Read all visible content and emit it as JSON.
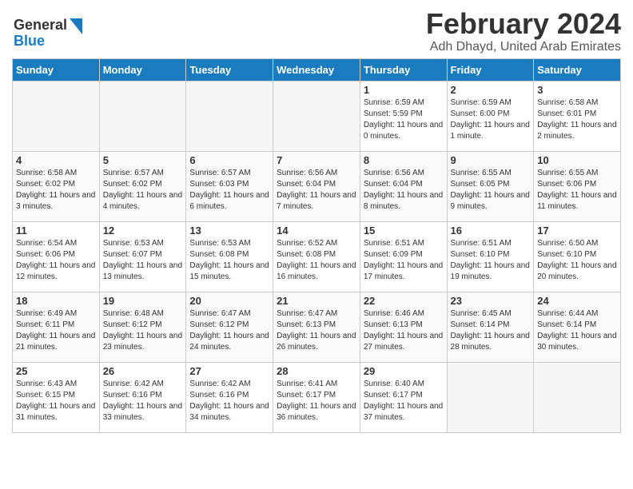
{
  "logo": {
    "line1": "General",
    "line2": "Blue"
  },
  "title": "February 2024",
  "location": "Adh Dhayd, United Arab Emirates",
  "headers": [
    "Sunday",
    "Monday",
    "Tuesday",
    "Wednesday",
    "Thursday",
    "Friday",
    "Saturday"
  ],
  "weeks": [
    [
      {
        "day": "",
        "info": ""
      },
      {
        "day": "",
        "info": ""
      },
      {
        "day": "",
        "info": ""
      },
      {
        "day": "",
        "info": ""
      },
      {
        "day": "1",
        "info": "Sunrise: 6:59 AM\nSunset: 5:59 PM\nDaylight: 11 hours\nand 0 minutes."
      },
      {
        "day": "2",
        "info": "Sunrise: 6:59 AM\nSunset: 6:00 PM\nDaylight: 11 hours\nand 1 minute."
      },
      {
        "day": "3",
        "info": "Sunrise: 6:58 AM\nSunset: 6:01 PM\nDaylight: 11 hours\nand 2 minutes."
      }
    ],
    [
      {
        "day": "4",
        "info": "Sunrise: 6:58 AM\nSunset: 6:02 PM\nDaylight: 11 hours\nand 3 minutes."
      },
      {
        "day": "5",
        "info": "Sunrise: 6:57 AM\nSunset: 6:02 PM\nDaylight: 11 hours\nand 4 minutes."
      },
      {
        "day": "6",
        "info": "Sunrise: 6:57 AM\nSunset: 6:03 PM\nDaylight: 11 hours\nand 6 minutes."
      },
      {
        "day": "7",
        "info": "Sunrise: 6:56 AM\nSunset: 6:04 PM\nDaylight: 11 hours\nand 7 minutes."
      },
      {
        "day": "8",
        "info": "Sunrise: 6:56 AM\nSunset: 6:04 PM\nDaylight: 11 hours\nand 8 minutes."
      },
      {
        "day": "9",
        "info": "Sunrise: 6:55 AM\nSunset: 6:05 PM\nDaylight: 11 hours\nand 9 minutes."
      },
      {
        "day": "10",
        "info": "Sunrise: 6:55 AM\nSunset: 6:06 PM\nDaylight: 11 hours\nand 11 minutes."
      }
    ],
    [
      {
        "day": "11",
        "info": "Sunrise: 6:54 AM\nSunset: 6:06 PM\nDaylight: 11 hours\nand 12 minutes."
      },
      {
        "day": "12",
        "info": "Sunrise: 6:53 AM\nSunset: 6:07 PM\nDaylight: 11 hours\nand 13 minutes."
      },
      {
        "day": "13",
        "info": "Sunrise: 6:53 AM\nSunset: 6:08 PM\nDaylight: 11 hours\nand 15 minutes."
      },
      {
        "day": "14",
        "info": "Sunrise: 6:52 AM\nSunset: 6:08 PM\nDaylight: 11 hours\nand 16 minutes."
      },
      {
        "day": "15",
        "info": "Sunrise: 6:51 AM\nSunset: 6:09 PM\nDaylight: 11 hours\nand 17 minutes."
      },
      {
        "day": "16",
        "info": "Sunrise: 6:51 AM\nSunset: 6:10 PM\nDaylight: 11 hours\nand 19 minutes."
      },
      {
        "day": "17",
        "info": "Sunrise: 6:50 AM\nSunset: 6:10 PM\nDaylight: 11 hours\nand 20 minutes."
      }
    ],
    [
      {
        "day": "18",
        "info": "Sunrise: 6:49 AM\nSunset: 6:11 PM\nDaylight: 11 hours\nand 21 minutes."
      },
      {
        "day": "19",
        "info": "Sunrise: 6:48 AM\nSunset: 6:12 PM\nDaylight: 11 hours\nand 23 minutes."
      },
      {
        "day": "20",
        "info": "Sunrise: 6:47 AM\nSunset: 6:12 PM\nDaylight: 11 hours\nand 24 minutes."
      },
      {
        "day": "21",
        "info": "Sunrise: 6:47 AM\nSunset: 6:13 PM\nDaylight: 11 hours\nand 26 minutes."
      },
      {
        "day": "22",
        "info": "Sunrise: 6:46 AM\nSunset: 6:13 PM\nDaylight: 11 hours\nand 27 minutes."
      },
      {
        "day": "23",
        "info": "Sunrise: 6:45 AM\nSunset: 6:14 PM\nDaylight: 11 hours\nand 28 minutes."
      },
      {
        "day": "24",
        "info": "Sunrise: 6:44 AM\nSunset: 6:14 PM\nDaylight: 11 hours\nand 30 minutes."
      }
    ],
    [
      {
        "day": "25",
        "info": "Sunrise: 6:43 AM\nSunset: 6:15 PM\nDaylight: 11 hours\nand 31 minutes."
      },
      {
        "day": "26",
        "info": "Sunrise: 6:42 AM\nSunset: 6:16 PM\nDaylight: 11 hours\nand 33 minutes."
      },
      {
        "day": "27",
        "info": "Sunrise: 6:42 AM\nSunset: 6:16 PM\nDaylight: 11 hours\nand 34 minutes."
      },
      {
        "day": "28",
        "info": "Sunrise: 6:41 AM\nSunset: 6:17 PM\nDaylight: 11 hours\nand 36 minutes."
      },
      {
        "day": "29",
        "info": "Sunrise: 6:40 AM\nSunset: 6:17 PM\nDaylight: 11 hours\nand 37 minutes."
      },
      {
        "day": "",
        "info": ""
      },
      {
        "day": "",
        "info": ""
      }
    ]
  ],
  "accent_color": "#1a7bbf"
}
